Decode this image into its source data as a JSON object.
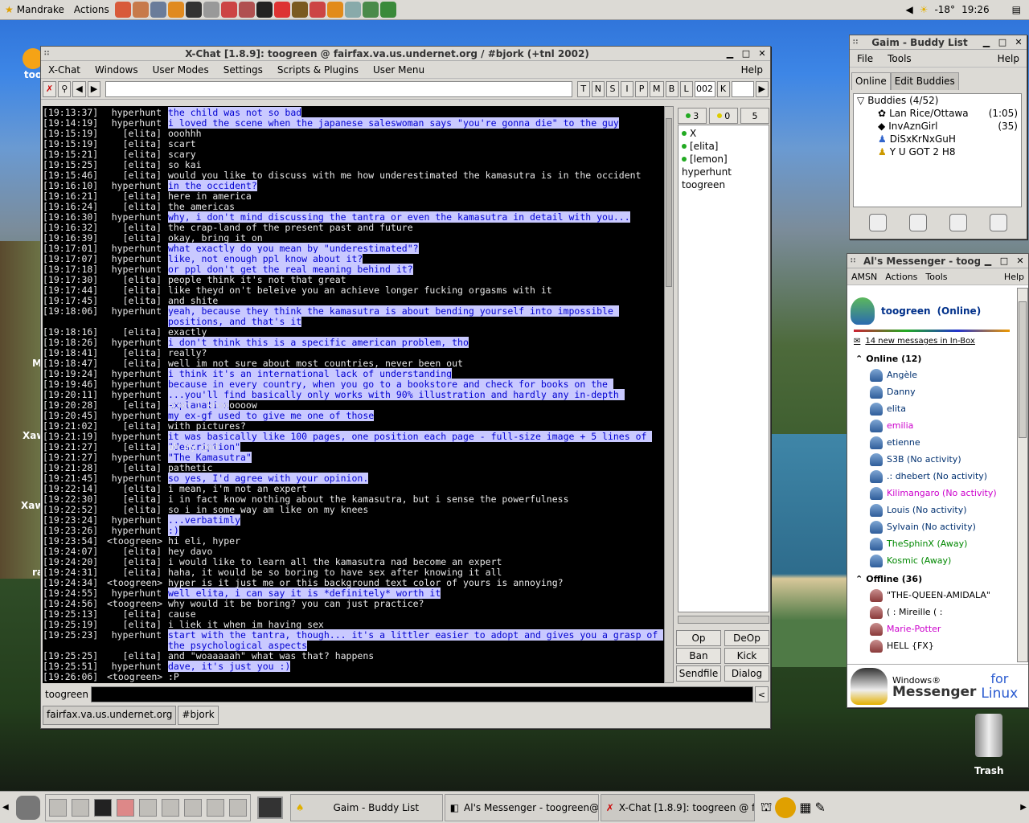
{
  "top_panel": {
    "menu_label": "Mandrake",
    "actions_label": "Actions",
    "temperature": "-18°",
    "clock": "19:26"
  },
  "desktop": {
    "trash_label": "Trash",
    "icon_labels": [
      "Xaw",
      "Xaw",
      "too",
      "M",
      "ra"
    ]
  },
  "xchat": {
    "title": "X-Chat [1.8.9]: toogreen @ fairfax.va.us.undernet.org / #bjork (+tnl 2002)",
    "menu": [
      "X-Chat",
      "Windows",
      "User Modes",
      "Settings",
      "Scripts & Plugins",
      "User Menu",
      "Help"
    ],
    "mode_buttons": [
      "T",
      "N",
      "S",
      "I",
      "P",
      "M",
      "B",
      "L"
    ],
    "limit_value": "002",
    "key_button": "K",
    "ops_count": "3",
    "voice_count": "0",
    "total_count": "5",
    "users": [
      "X",
      "[elita]",
      "[lemon]",
      "hyperhunt",
      "toogreen"
    ],
    "action_buttons": [
      "Op",
      "DeOp",
      "Ban",
      "Kick",
      "Sendfile",
      "Dialog"
    ],
    "input_nick": "toogreen",
    "tabs": [
      "fairfax.va.us.undernet.org",
      "#bjork"
    ],
    "log": [
      {
        "t": "[19:13:37]",
        "n": "hyperhunt",
        "m": "the child was not so bad",
        "h": true
      },
      {
        "t": "[19:14:19]",
        "n": "hyperhunt",
        "m": "i loved the scene when the japanese saleswoman says \"you're gonna die\" to the guy",
        "h": true
      },
      {
        "t": "[19:15:19]",
        "n": "[elita]",
        "m": "ooohhh",
        "h": false
      },
      {
        "t": "[19:15:19]",
        "n": "[elita]",
        "m": "scart",
        "h": false
      },
      {
        "t": "[19:15:21]",
        "n": "[elita]",
        "m": "scary",
        "h": false
      },
      {
        "t": "[19:15:25]",
        "n": "[elita]",
        "m": "so kai",
        "h": false
      },
      {
        "t": "[19:15:46]",
        "n": "[elita]",
        "m": "would you like to discuss with me how underestimated the kamasutra is in the occident",
        "h": false
      },
      {
        "t": "[19:16:10]",
        "n": "hyperhunt",
        "m": "in the occident?",
        "h": true
      },
      {
        "t": "[19:16:21]",
        "n": "[elita]",
        "m": "here in america",
        "h": false
      },
      {
        "t": "[19:16:24]",
        "n": "[elita]",
        "m": "the americas",
        "h": false
      },
      {
        "t": "[19:16:30]",
        "n": "hyperhunt",
        "m": "why, i don't mind discussing the tantra or even the kamasutra in detail with you...",
        "h": true
      },
      {
        "t": "[19:16:32]",
        "n": "[elita]",
        "m": "the crap-land of the present past and future",
        "h": false
      },
      {
        "t": "[19:16:39]",
        "n": "[elita]",
        "m": "okay, bring it on",
        "h": false
      },
      {
        "t": "[19:17:01]",
        "n": "hyperhunt",
        "m": "what exactly do you mean by \"underestimated\"?",
        "h": true
      },
      {
        "t": "[19:17:07]",
        "n": "hyperhunt",
        "m": "like, not enough ppl know about it?",
        "h": true
      },
      {
        "t": "[19:17:18]",
        "n": "hyperhunt",
        "m": "or ppl don't get the real meaning behind it?",
        "h": true
      },
      {
        "t": "[19:17:30]",
        "n": "[elita]",
        "m": "people think it's not that great",
        "h": false
      },
      {
        "t": "[19:17:44]",
        "n": "[elita]",
        "m": "like theyd on't beleive you an achieve longer fucking orgasms with it",
        "h": false
      },
      {
        "t": "[19:17:45]",
        "n": "[elita]",
        "m": "and shite",
        "h": false
      },
      {
        "t": "[19:18:06]",
        "n": "hyperhunt",
        "m": "yeah, because they think the kamasutra is about bending yourself into impossible positions, and that's it",
        "h": true,
        "tall": true
      },
      {
        "t": "[19:18:16]",
        "n": "[elita]",
        "m": "exactly",
        "h": false
      },
      {
        "t": "[19:18:26]",
        "n": "hyperhunt",
        "m": "i don't think this is a specific american problem, tho",
        "h": true
      },
      {
        "t": "[19:18:41]",
        "n": "[elita]",
        "m": "really?",
        "h": false
      },
      {
        "t": "[19:18:47]",
        "n": "[elita]",
        "m": "well im not sure about most countries, never been out",
        "h": false
      },
      {
        "t": "[19:19:24]",
        "n": "hyperhunt",
        "m": "i think it's an international lack of understanding",
        "h": true
      },
      {
        "t": "[19:19:46]",
        "n": "hyperhunt",
        "m": "because in every country, when you go to a bookstore and check for books on the kamasutra...",
        "h": true
      },
      {
        "t": "[19:20:11]",
        "n": "hyperhunt",
        "m": "...you'll find basically only works with 90% illustration and hardly any in-depth explanation",
        "h": true
      },
      {
        "t": "[19:20:28]",
        "n": "[elita]",
        "m": "oooh i knoooooow",
        "h": false
      },
      {
        "t": "[19:20:45]",
        "n": "hyperhunt",
        "m": "my ex-gf used to give me one of those",
        "h": true
      },
      {
        "t": "[19:21:02]",
        "n": "[elita]",
        "m": "with pictures?",
        "h": false
      },
      {
        "t": "[19:21:19]",
        "n": "hyperhunt",
        "m": "it was basically like 100 pages, one position each page - full-size image + 5 lines of \"description\"",
        "h": true
      },
      {
        "t": "[19:21:27]",
        "n": "[elita]",
        "m": "oh my god",
        "h": false
      },
      {
        "t": "[19:21:27]",
        "n": "hyperhunt",
        "m": "\"The Kamasutra\"",
        "h": true
      },
      {
        "t": "[19:21:28]",
        "n": "[elita]",
        "m": "pathetic",
        "h": false
      },
      {
        "t": "[19:21:45]",
        "n": "hyperhunt",
        "m": "so yes, I'd agree with your opinion.",
        "h": true
      },
      {
        "t": "[19:22:14]",
        "n": "[elita]",
        "m": "i mean, i'm not an expert",
        "h": false
      },
      {
        "t": "[19:22:30]",
        "n": "[elita]",
        "m": "i in fact know nothing about the kamasutra, but i sense the powerfulness",
        "h": false
      },
      {
        "t": "[19:22:52]",
        "n": "[elita]",
        "m": "so i in some way am like on my knees",
        "h": false
      },
      {
        "t": "[19:23:24]",
        "n": "hyperhunt",
        "m": "...verbatimly",
        "h": true
      },
      {
        "t": "[19:23:26]",
        "n": "hyperhunt",
        "m": ":)",
        "h": true
      },
      {
        "t": "[19:23:54]",
        "n": "<toogreen>",
        "m": "hi eli, hyper",
        "h": false
      },
      {
        "t": "[19:24:07]",
        "n": "[elita]",
        "m": "hey davo",
        "h": false
      },
      {
        "t": "[19:24:20]",
        "n": "[elita]",
        "m": "i would like to learn all the kamasutra nad become an expert",
        "h": false
      },
      {
        "t": "[19:24:31]",
        "n": "[elita]",
        "m": "haha, it would be so boring to have sex after knowing it all",
        "h": false
      },
      {
        "t": "[19:24:34]",
        "n": "<toogreen>",
        "m": "hyper is it just me or this background text color of yours is annoying?",
        "h": false
      },
      {
        "t": "[19:24:55]",
        "n": "hyperhunt",
        "m": "well elita, i can say it is *definitely* worth it",
        "h": true
      },
      {
        "t": "[19:24:56]",
        "n": "<toogreen>",
        "m": "why would it be boring? you can just practice?",
        "h": false
      },
      {
        "t": "[19:25:13]",
        "n": "[elita]",
        "m": "cause",
        "h": false
      },
      {
        "t": "[19:25:19]",
        "n": "[elita]",
        "m": "i liek it when im having sex",
        "h": false
      },
      {
        "t": "[19:25:23]",
        "n": "hyperhunt",
        "m": "start with the tantra, though... it's a littler easier to adopt and gives you a grasp of the psychological aspects",
        "h": true,
        "tall": true
      },
      {
        "t": "[19:25:25]",
        "n": "[elita]",
        "m": "and \"woaaaaah\" what was that? happens",
        "h": false
      },
      {
        "t": "[19:25:51]",
        "n": "hyperhunt",
        "m": "dave, it's just you :)",
        "h": true
      },
      {
        "t": "[19:26:06]",
        "n": "<toogreen>",
        "m": ":P",
        "h": false
      }
    ]
  },
  "gaim": {
    "title": "Gaim - Buddy List",
    "menu": [
      "File",
      "Tools",
      "Help"
    ],
    "tabs": [
      "Online",
      "Edit Buddies"
    ],
    "group": "Buddies (4/52)",
    "buddies": [
      {
        "name": "Lan Rice/Ottawa",
        "idle": "(1:05)"
      },
      {
        "name": "InvAznGirl",
        "idle": "(35)"
      },
      {
        "name": "DiSxKrNxGuH",
        "idle": ""
      },
      {
        "name": "Y U GOT 2 H8",
        "idle": ""
      }
    ]
  },
  "amsn": {
    "title": "Al's Messenger - toogre",
    "menu": [
      "AMSN",
      "Actions",
      "Tools",
      "Help"
    ],
    "my_name": "toogreen",
    "my_status": "(Online)",
    "inbox": "14 new messages in In-Box",
    "online_header": "Online (12)",
    "online": [
      "Angèle",
      "Danny",
      "elita",
      "emilia",
      "etienne",
      "S3B (No activity)",
      ".: dhebert (No activity)",
      "Kilimangaro (No activity)",
      "Louis (No activity)",
      "Sylvain (No activity)",
      "TheSphinX (Away)",
      "Kosmic (Away)"
    ],
    "offline_header": "Offline (36)",
    "offline": [
      "\"THE-QUEEN-AMIDALA\"",
      "( : Mireille ( :",
      "Marie-Potter",
      "HELL {FX}"
    ],
    "banner_windows": "Windows®",
    "banner_messenger": "Messenger",
    "banner_for": "for",
    "banner_linux": "Linux"
  },
  "taskbar": {
    "items": [
      "Gaim - Buddy List",
      "Al's Messenger - toogreen@h",
      "X-Chat [1.8.9]: toogreen @ fa"
    ]
  }
}
